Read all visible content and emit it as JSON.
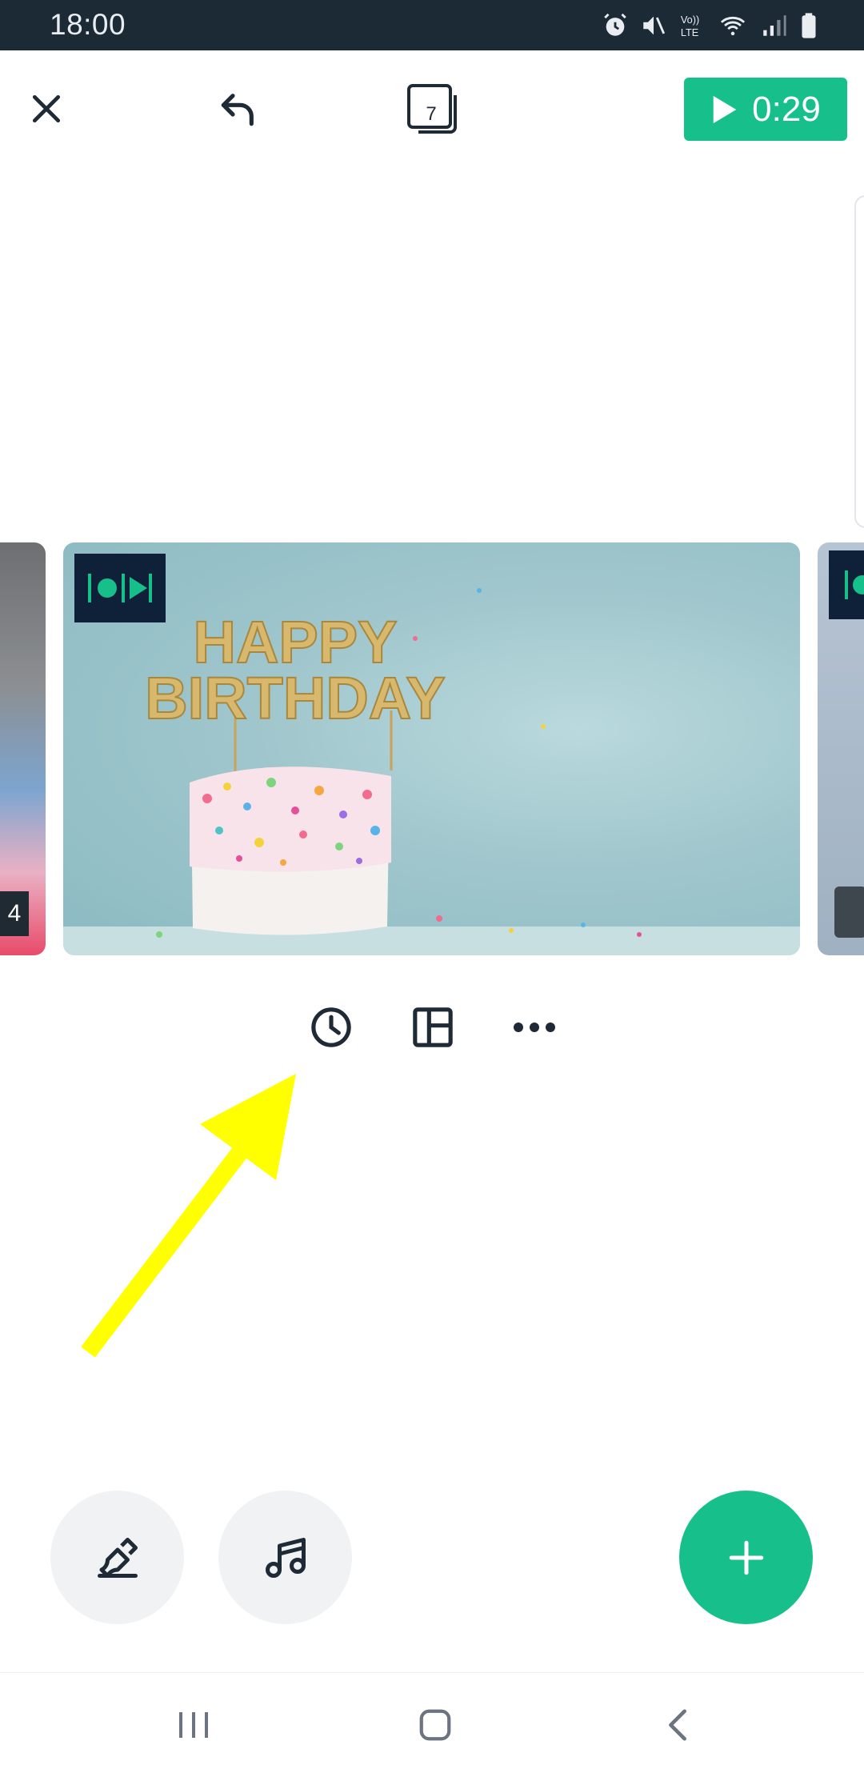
{
  "status_bar": {
    "time": "18:00",
    "icons": [
      "alarm-icon",
      "mute-icon",
      "volte-icon",
      "wifi-icon",
      "signal-icon",
      "battery-icon"
    ],
    "volte_label": "Vo))\nLTE"
  },
  "toolbar": {
    "slide_count": "7",
    "play_duration": "0:29"
  },
  "carousel": {
    "prev_slide_number": "4",
    "main_slide": {
      "topper_line1": "HAPPY",
      "topper_line2": "BIRTHDAY"
    }
  },
  "colors": {
    "accent": "#17c08a",
    "status_bar": "#1c2a36",
    "icon_dark": "#1e2a36",
    "transition_badge": "#0f2138",
    "annotation_arrow": "#ffff00"
  }
}
